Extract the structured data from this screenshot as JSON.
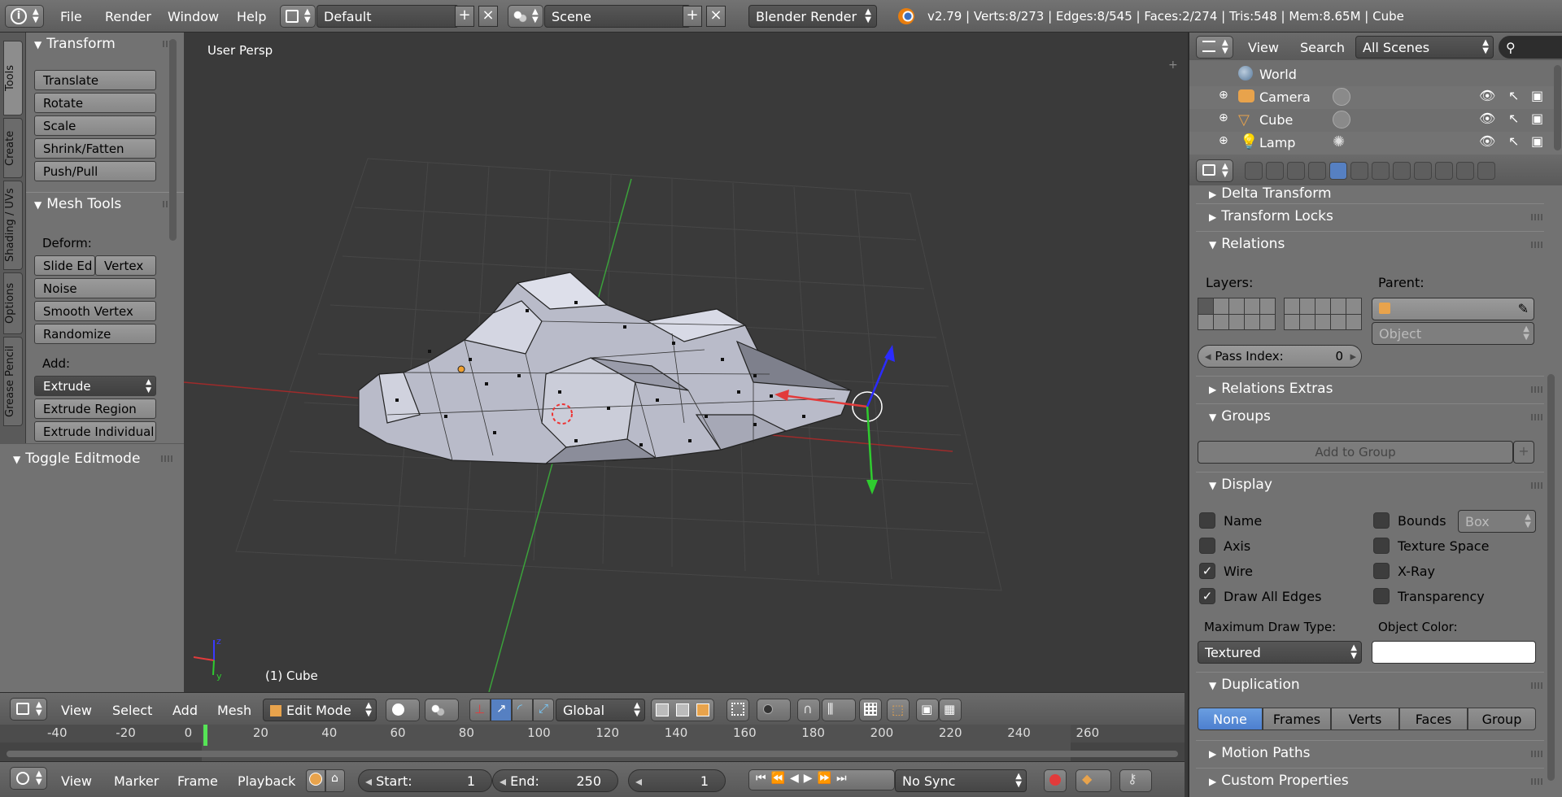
{
  "topbar": {
    "menus": [
      "File",
      "Render",
      "Window",
      "Help"
    ],
    "layout": "Default",
    "scene": "Scene",
    "engine": "Blender Render",
    "stats": "v2.79 | Verts:8/273 | Edges:8/545 | Faces:2/274 | Tris:548 | Mem:8.65M | Cube"
  },
  "tabs": [
    "Tools",
    "Create",
    "Shading / UVs",
    "Options",
    "Grease Pencil"
  ],
  "shelf": {
    "transform_title": "Transform",
    "transform_buttons": [
      "Translate",
      "Rotate",
      "Scale",
      "Shrink/Fatten",
      "Push/Pull"
    ],
    "mesh_title": "Mesh Tools",
    "deform_label": "Deform:",
    "slide_edge": "Slide Ed",
    "vertex": "Vertex",
    "deform_buttons": [
      "Noise",
      "Smooth Vertex",
      "Randomize"
    ],
    "add_label": "Add:",
    "extrude": "Extrude",
    "add_buttons": [
      "Extrude Region",
      "Extrude Individual"
    ],
    "toggle_title": "Toggle Editmode"
  },
  "viewport": {
    "view_name": "User Persp",
    "object_label": "(1) Cube"
  },
  "viewheader": {
    "menus": [
      "View",
      "Select",
      "Add",
      "Mesh"
    ],
    "mode": "Edit Mode",
    "orientation": "Global"
  },
  "timeline": {
    "ticks": [
      "-40",
      "-20",
      "0",
      "20",
      "40",
      "60",
      "80",
      "100",
      "120",
      "140",
      "160",
      "180",
      "200",
      "220",
      "240",
      "260"
    ],
    "menus": [
      "View",
      "Marker",
      "Frame",
      "Playback"
    ],
    "start_label": "Start:",
    "start": "1",
    "end_label": "End:",
    "end": "250",
    "current": "1",
    "sync": "No Sync"
  },
  "outliner": {
    "menus": [
      "View",
      "Search"
    ],
    "filter": "All Scenes",
    "rows": [
      {
        "name": "World",
        "icon": "world-icon"
      },
      {
        "name": "Camera",
        "icon": "camera-icon"
      },
      {
        "name": "Cube",
        "icon": "mesh-icon"
      },
      {
        "name": "Lamp",
        "icon": "lamp-icon"
      }
    ]
  },
  "props": {
    "delta_transform": "Delta Transform",
    "transform_locks": "Transform Locks",
    "relations": "Relations",
    "layers_label": "Layers:",
    "parent_label": "Parent:",
    "parent_type": "Object",
    "pass_index_label": "Pass Index:",
    "pass_index": "0",
    "relations_extras": "Relations Extras",
    "groups": "Groups",
    "add_to_group": "Add to Group",
    "display": "Display",
    "display_checks": [
      {
        "label": "Name",
        "checked": false
      },
      {
        "label": "Axis",
        "checked": false
      },
      {
        "label": "Wire",
        "checked": true
      },
      {
        "label": "Draw All Edges",
        "checked": true
      }
    ],
    "display_checks_right": [
      {
        "label": "Bounds",
        "checked": false
      },
      {
        "label": "Texture Space",
        "checked": false
      },
      {
        "label": "X-Ray",
        "checked": false
      },
      {
        "label": "Transparency",
        "checked": false
      }
    ],
    "bounds_type": "Box",
    "max_draw_label": "Maximum Draw Type:",
    "max_draw": "Textured",
    "object_color_label": "Object Color:",
    "duplication": "Duplication",
    "dup_options": [
      "None",
      "Frames",
      "Verts",
      "Faces",
      "Group"
    ],
    "dup_selected": "None",
    "motion_paths": "Motion Paths",
    "custom_properties": "Custom Properties"
  },
  "colors": {
    "accent": "#5680c2",
    "x_axis": "#e23b3b",
    "y_axis": "#2fcc2f",
    "z_axis": "#2b2bff"
  }
}
